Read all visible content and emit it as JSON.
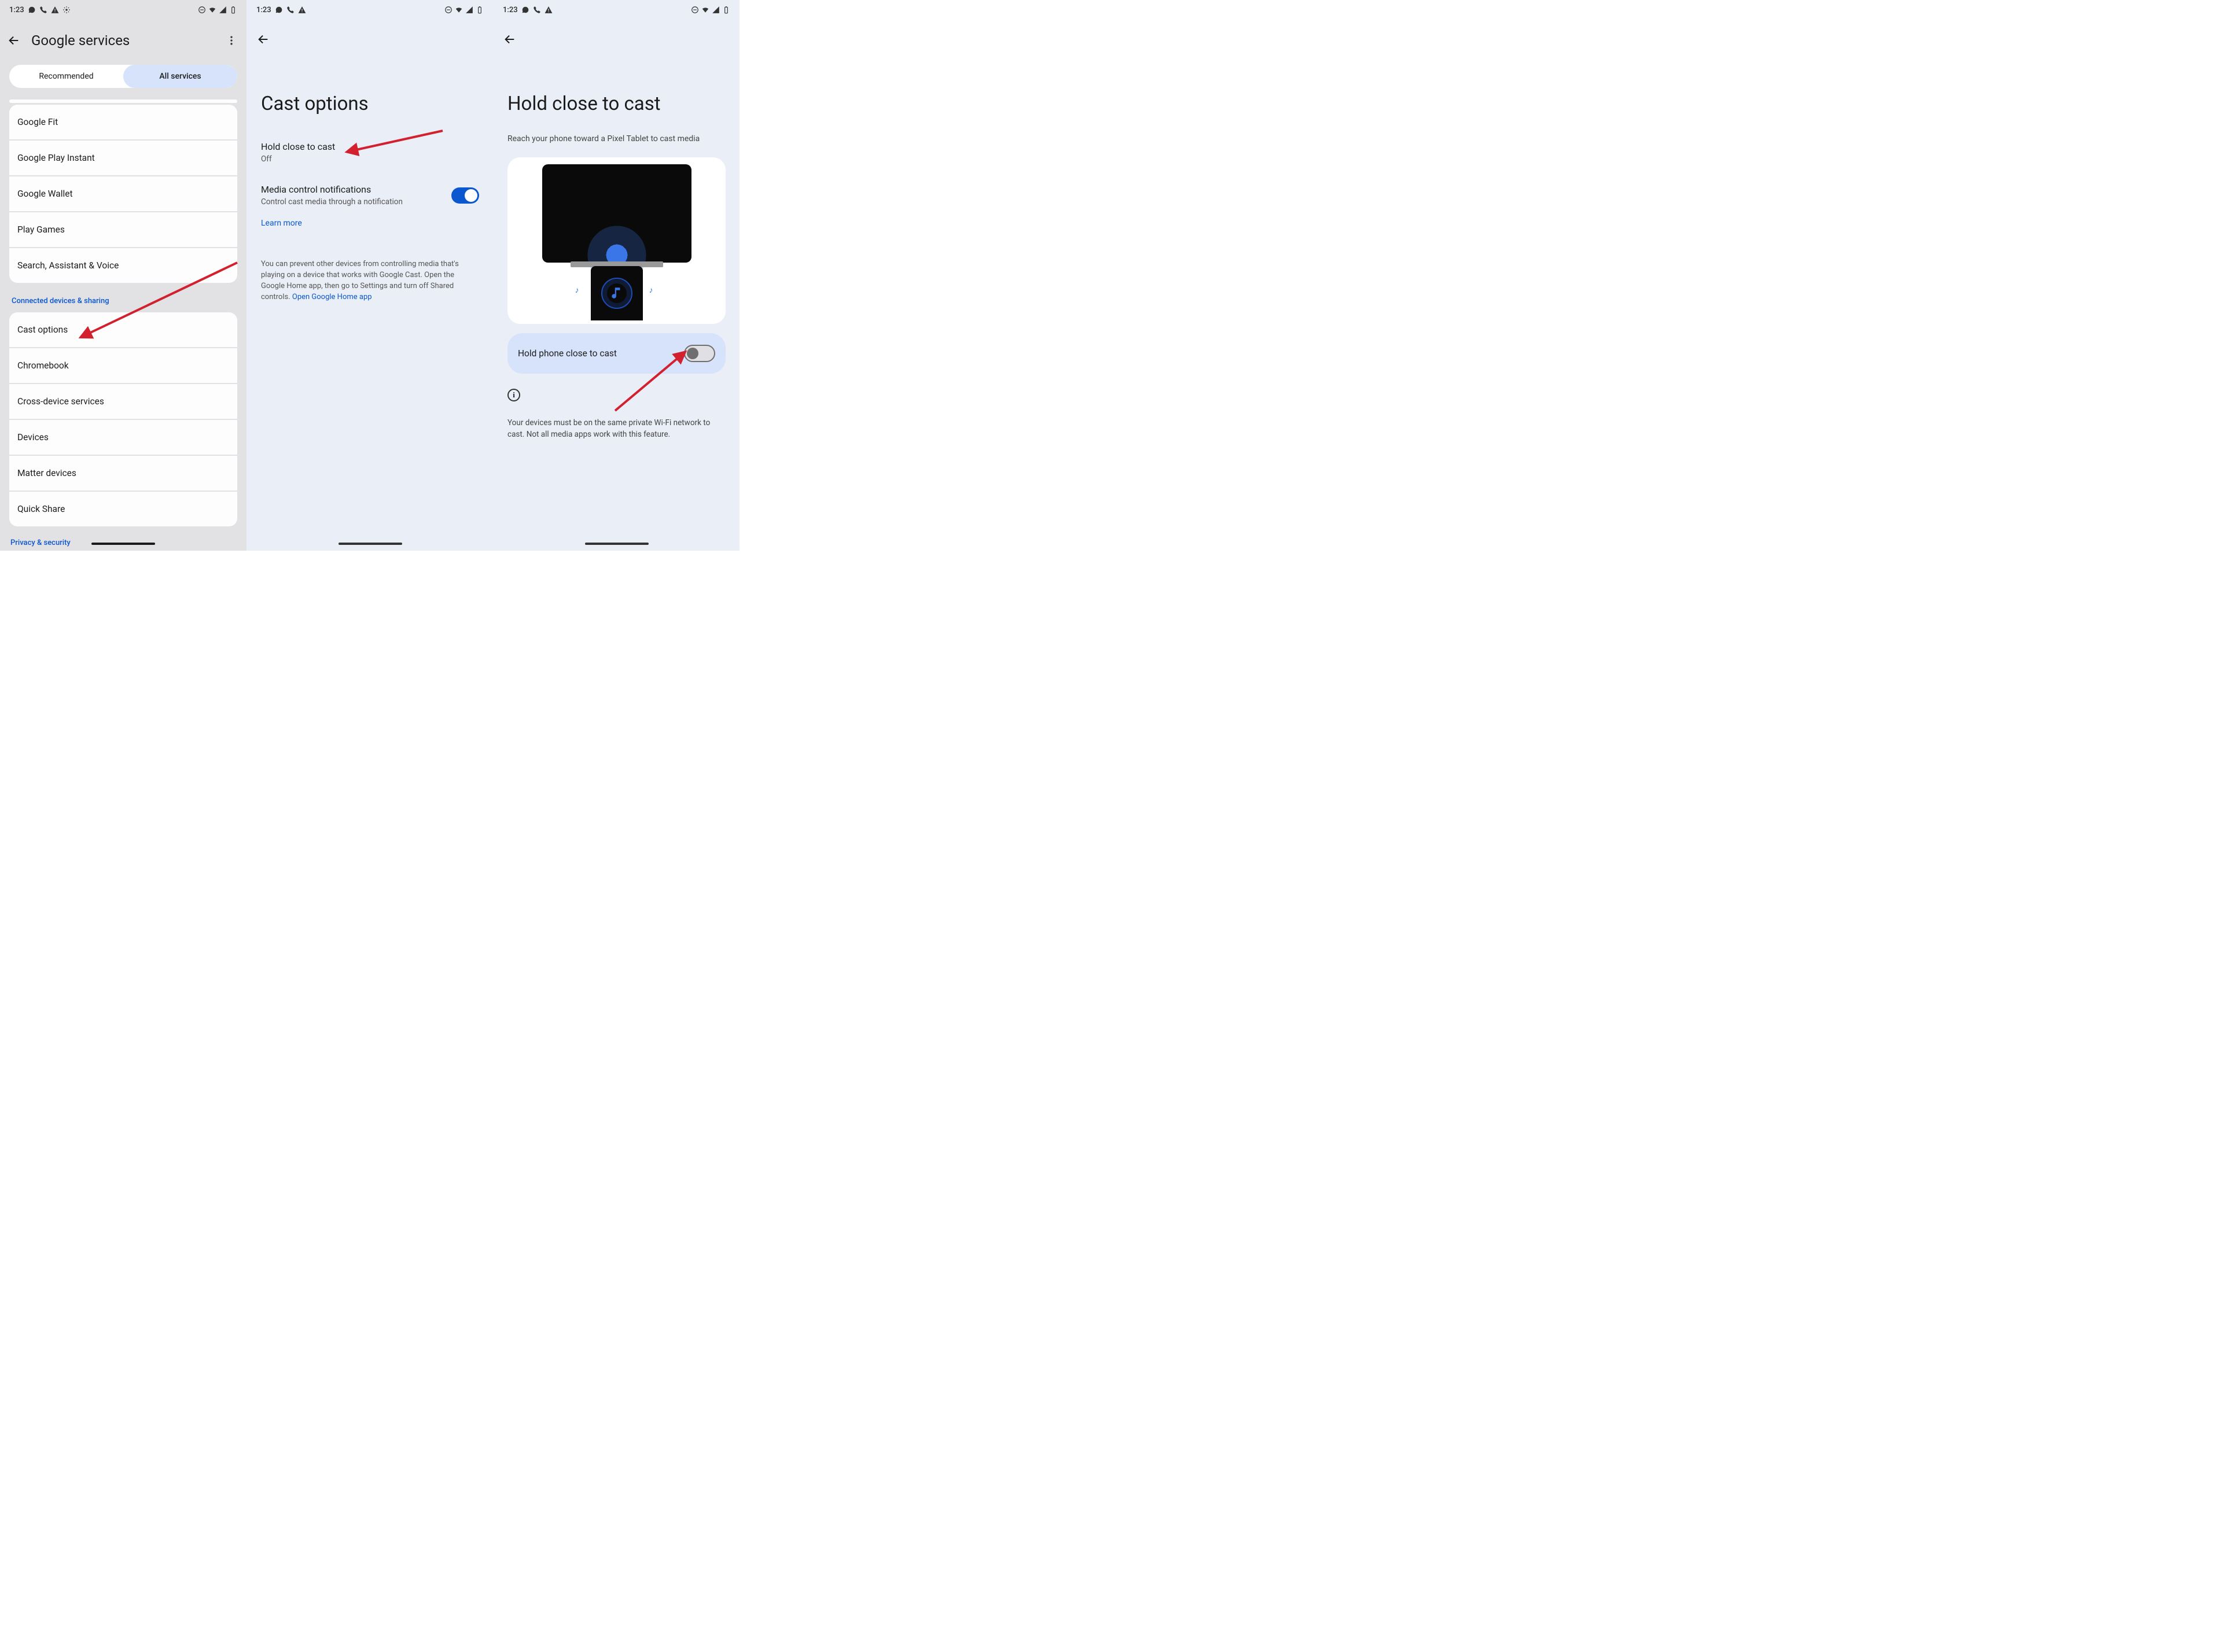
{
  "status": {
    "time": "1:23"
  },
  "screen1": {
    "title": "Google services",
    "tabs": {
      "recommended": "Recommended",
      "all": "All services"
    },
    "group_a": [
      "Google Fit",
      "Google Play Instant",
      "Google Wallet",
      "Play Games",
      "Search, Assistant & Voice"
    ],
    "section_label": "Connected devices & sharing",
    "group_b": [
      "Cast options",
      "Chromebook",
      "Cross-device services",
      "Devices",
      "Matter devices",
      "Quick Share"
    ],
    "bottom_link": "Privacy & security"
  },
  "screen2": {
    "title": "Cast options",
    "opt1": {
      "label": "Hold close to cast",
      "sub": "Off"
    },
    "opt2": {
      "label": "Media control notifications",
      "sub": "Control cast media through a notification",
      "on": true
    },
    "learn": "Learn more",
    "footnote_a": "You can prevent other devices from controlling media that's playing on a device that works with Google Cast. Open the Google Home app, then go to Settings and turn off Shared controls. ",
    "footnote_link": "Open Google Home app"
  },
  "screen3": {
    "title": "Hold close to cast",
    "subtitle": "Reach your phone toward a Pixel Tablet to cast media",
    "toggle_label": "Hold phone close to cast",
    "toggle_on": false,
    "footnote": "Your devices must be on the same private Wi-Fi network to cast. Not all media apps work with this feature."
  }
}
